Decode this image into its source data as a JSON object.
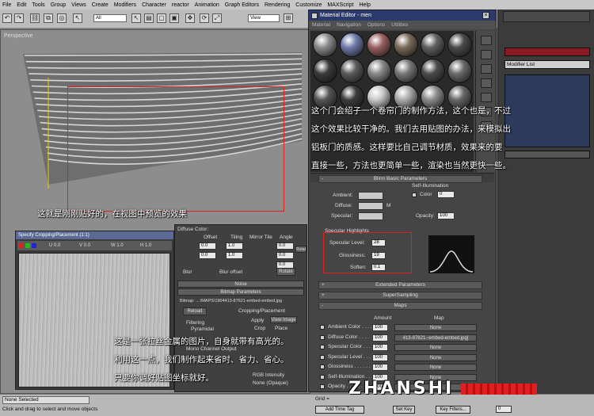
{
  "menubar": [
    "File",
    "Edit",
    "Tools",
    "Group",
    "Views",
    "Create",
    "Modifiers",
    "Character",
    "reactor",
    "Animation",
    "Graph Editors",
    "Rendering",
    "Customize",
    "MAXScript",
    "Help"
  ],
  "toolbar": {
    "selection_filter": "All",
    "ref_coord": "View"
  },
  "viewport": {
    "label": "Perspective"
  },
  "command_panel": {
    "modifier_list": "Modifier List"
  },
  "material_editor": {
    "title": "Material Editor - men",
    "menu": [
      "Material",
      "Navigation",
      "Options",
      "Utilities"
    ],
    "rollouts": {
      "blinn_basic": "Blinn Basic Parameters",
      "extended": "Extended Parameters",
      "supersampling": "SuperSampling",
      "maps": "Maps"
    },
    "basic": {
      "ambient": "Ambient:",
      "diffuse": "Diffuse:",
      "specular": "Specular:",
      "self_illum": "Self-Illumination",
      "color": "Color",
      "color_val": "0",
      "opacity": "Opacity:",
      "opacity_val": "100",
      "m": "M"
    },
    "spec": {
      "group": "Specular Highlights",
      "level": "Specular Level:",
      "level_val": "28",
      "gloss": "Glossiness:",
      "gloss_val": "19",
      "soften": "Soften:",
      "soften_val": "0.1"
    },
    "maps": {
      "header_amount": "Amount",
      "header_map": "Map",
      "rows": [
        {
          "name": "Ambient Color . . . .",
          "amount": "100",
          "map": "None"
        },
        {
          "name": "Diffuse Color . . . .",
          "amount": "100",
          "map": "413-87621--embed-embed.jpg]"
        },
        {
          "name": "Specular Color . . .",
          "amount": "100",
          "map": "None"
        },
        {
          "name": "Specular Level . . .",
          "amount": "100",
          "map": "None"
        },
        {
          "name": "Glossiness . . . . . .",
          "amount": "100",
          "map": "None"
        },
        {
          "name": "Self-Illumination . .",
          "amount": "100",
          "map": "None"
        },
        {
          "name": "Opacity . . . . . . .",
          "amount": "100",
          "map": "None"
        }
      ]
    }
  },
  "crop_window": {
    "title": "Specify Cropping/Placement (1:1)",
    "u": "U 0.0",
    "v": "V 0.0",
    "w": "W 1.0",
    "h": "H 1.0"
  },
  "bitmap_panel": {
    "diffuse": "Diffuse Color:",
    "bitmap_params": "Bitmap Parameters",
    "noise": "Noise",
    "bitmap_path": "Bitmap: …\\MAPS\\1904413-87621-embed-embed.jpg",
    "reload": "Reload",
    "cropping": "Cropping/Placement",
    "apply": "Apply",
    "view_image": "View Image",
    "crop": "Crop",
    "place": "Place",
    "filtering": "Filtering",
    "pyramidal": "Pyramidal",
    "mono": "Mono Channel Output",
    "rgb_intensity": "RGB Intensity",
    "none_opaque": "None (Opaque)",
    "offset": "Offset",
    "tiling": "Tiling",
    "mirror_tile": "Mirror Tile",
    "angle": "Angle",
    "blur": "Blur",
    "blur_offset": "Blur offset",
    "rotate": "Rotate",
    "rotate_short": "Rotat"
  },
  "annotations": {
    "top": [
      "这个门会绍子一个卷帘门的制作方法，这个也是，不过",
      "这个效果比较干净的。我们去用贴图的办法，来模拟出",
      "铝板门的质感。这样要比自己调节材质，效果来的要",
      "直接一些，方法也更简单一些，渲染也当然更快一些。"
    ],
    "viewport": "这就是刚刚贴好的，在视图中预览的效果",
    "bottom": [
      "这是一张拉丝金属的图片，自身就带有高光的。",
      "利用这一点，我们制作起来省时、省力、省心。",
      "只要你调好贴图坐标就好。"
    ]
  },
  "status": {
    "selected": "None Selected",
    "hint": "Click and drag to select and move objects",
    "grid": "Grid = ",
    "add_time_tag": "Add Time Tag",
    "set_key": "Set Key",
    "key_filters": "Key Filters...",
    "zero": "0"
  },
  "watermark": "ZHANSHI",
  "colors": {
    "red_outline": "#e02020",
    "title_blue": "#2b3a6c",
    "slat": "#c8c8c8"
  }
}
